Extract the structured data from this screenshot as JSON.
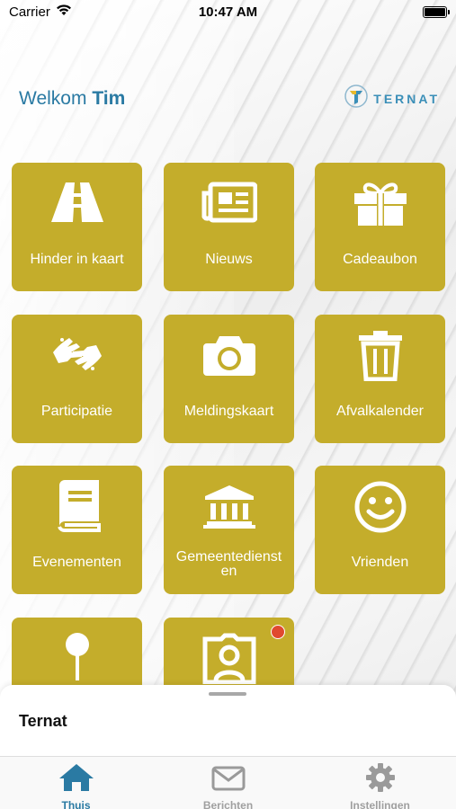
{
  "status_bar": {
    "carrier": "Carrier",
    "time": "10:47 AM"
  },
  "header": {
    "greeting": "Welkom",
    "user_name": "Tim",
    "logo_text": "TERNAT"
  },
  "colors": {
    "tile": "#c4ad2b",
    "accent": "#2a7aa3",
    "badge": "#e04a2f"
  },
  "tiles": [
    {
      "label": "Hinder in kaart",
      "icon": "road-icon"
    },
    {
      "label": "Nieuws",
      "icon": "newspaper-icon"
    },
    {
      "label": "Cadeaubon",
      "icon": "gift-icon"
    },
    {
      "label": "Participatie",
      "icon": "hands-icon"
    },
    {
      "label": "Meldingskaart",
      "icon": "camera-icon"
    },
    {
      "label": "Afvalkalender",
      "icon": "trash-icon"
    },
    {
      "label": "Evenementen",
      "icon": "book-icon"
    },
    {
      "label": "Gemeentedienst\nen",
      "icon": "building-icon"
    },
    {
      "label": "Vrienden",
      "icon": "smiley-icon"
    },
    {
      "label": "",
      "icon": "pin-icon"
    },
    {
      "label": "",
      "icon": "id-card-icon"
    }
  ],
  "sheet": {
    "title": "Ternat"
  },
  "tabbar": {
    "items": [
      {
        "label": "Thuis",
        "icon": "home-icon",
        "active": true
      },
      {
        "label": "Berichten",
        "icon": "envelope-icon",
        "active": false
      },
      {
        "label": "Instellingen",
        "icon": "gear-icon",
        "active": false
      }
    ]
  }
}
